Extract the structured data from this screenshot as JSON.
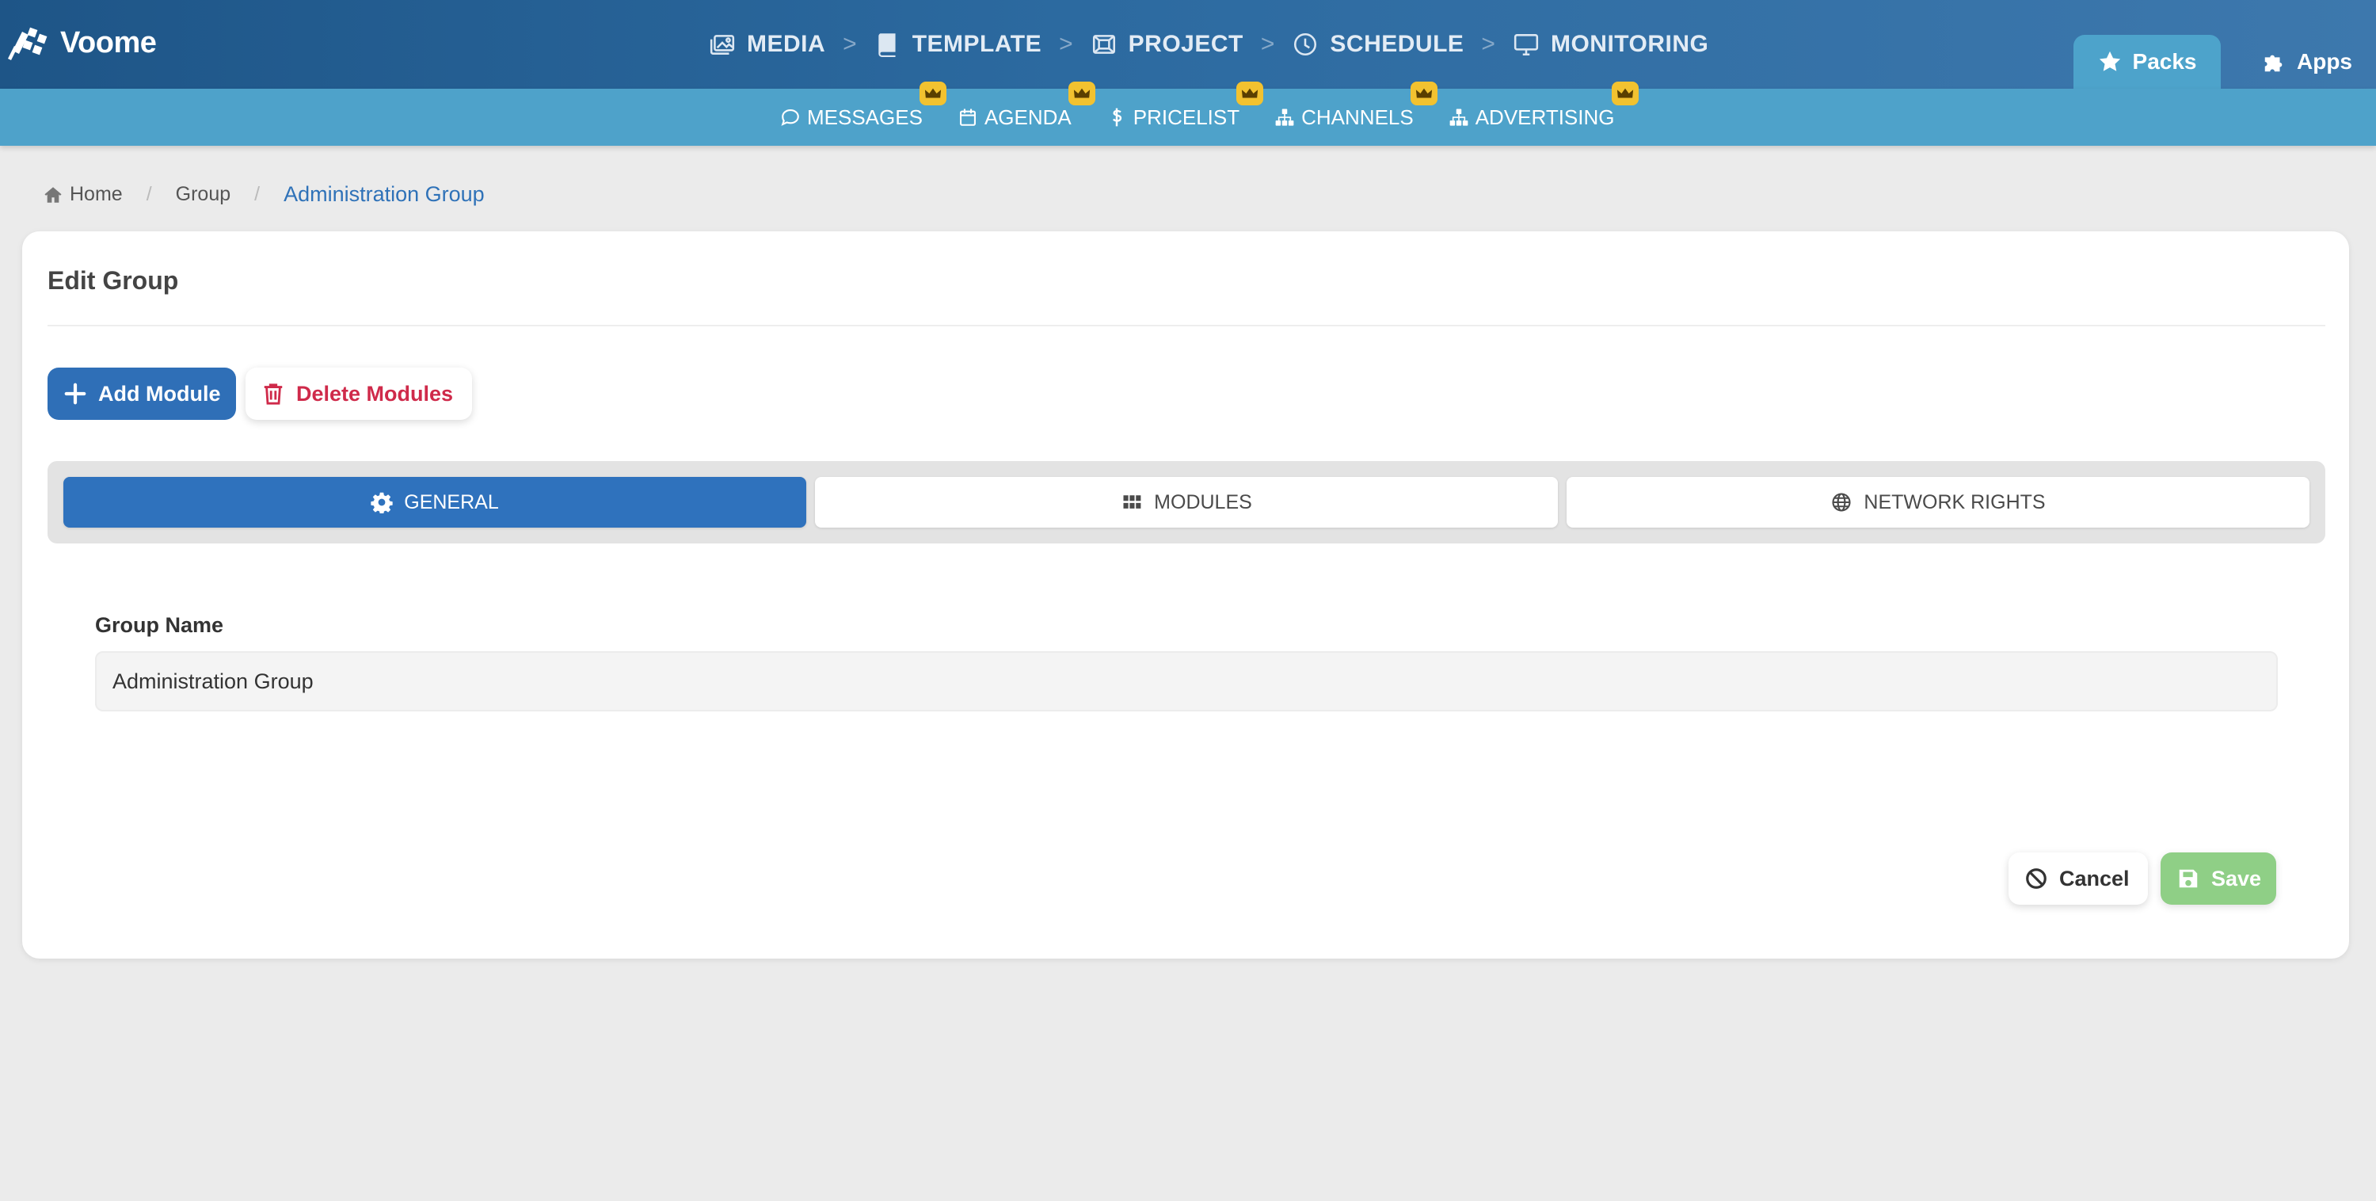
{
  "app": {
    "logo_text": "Voome"
  },
  "main_nav": {
    "items": [
      {
        "label": "MEDIA",
        "icon": "images-icon"
      },
      {
        "label": "TEMPLATE",
        "icon": "book-icon"
      },
      {
        "label": "PROJECT",
        "icon": "project-icon"
      },
      {
        "label": "SCHEDULE",
        "icon": "clock-icon"
      },
      {
        "label": "MONITORING",
        "icon": "monitor-icon"
      }
    ],
    "separator": ">"
  },
  "right_tabs": {
    "packs_label": "Packs",
    "apps_label": "Apps"
  },
  "sub_nav": {
    "items": [
      {
        "label": "MESSAGES",
        "icon": "comment-icon",
        "premium": true
      },
      {
        "label": "AGENDA",
        "icon": "calendar-icon",
        "premium": true
      },
      {
        "label": "PRICELIST",
        "icon": "dollar-icon",
        "premium": true
      },
      {
        "label": "CHANNELS",
        "icon": "sitemap-icon",
        "premium": true
      },
      {
        "label": "ADVERTISING",
        "icon": "sitemap-icon",
        "premium": true
      }
    ]
  },
  "breadcrumb": {
    "home": "Home",
    "group": "Group",
    "current": "Administration Group",
    "separator": "/"
  },
  "card": {
    "title": "Edit Group",
    "add_module_label": "Add Module",
    "delete_modules_label": "Delete Modules"
  },
  "tabs": {
    "general": "GENERAL",
    "modules": "MODULES",
    "network_rights": "NETWORK RIGHTS",
    "active": "general"
  },
  "form": {
    "group_name_label": "Group Name",
    "group_name_value": "Administration Group"
  },
  "actions": {
    "cancel_label": "Cancel",
    "save_label": "Save"
  },
  "colors": {
    "topbar": "#2c6aa0",
    "subbar": "#4ea2ca",
    "primary": "#2f6fb7",
    "danger": "#cf2a4a",
    "save": "#8fcf86",
    "crown": "#f2c230"
  }
}
